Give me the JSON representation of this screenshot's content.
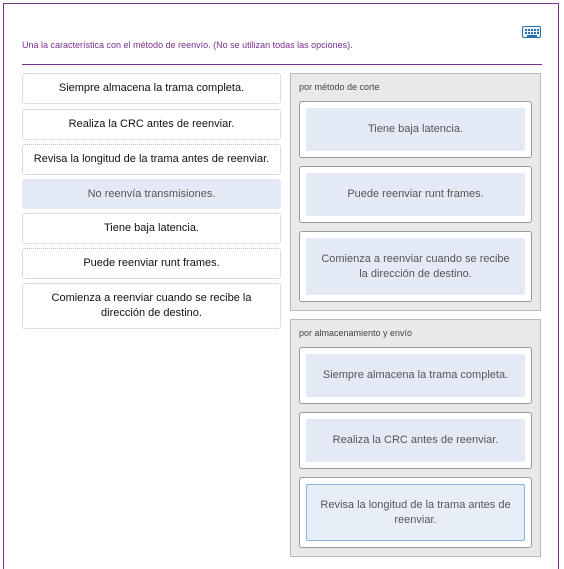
{
  "instruction": "Una la característica con el método de reenvío. (No se utilizan todas las opciones).",
  "keyboard_icon": "keyboard-icon",
  "options": [
    {
      "label": "Siempre almacena la trama completa.",
      "used": false
    },
    {
      "label": "Realiza la CRC antes de reenviar.",
      "used": false
    },
    {
      "label": "Revisa la longitud de la trama antes de reenviar.",
      "used": false
    },
    {
      "label": "No reenvía transmisiones.",
      "used": true
    },
    {
      "label": "Tiene baja latencia.",
      "used": false
    },
    {
      "label": "Puede reenviar runt frames.",
      "used": false
    },
    {
      "label": "Comienza a reenviar cuando se recibe la dirección de destino.",
      "used": false
    }
  ],
  "zones": [
    {
      "title": "por método de corte",
      "items": [
        "Tiene baja latencia.",
        "Puede reenviar runt frames.",
        "Comienza a reenviar cuando se recibe la dirección de destino."
      ]
    },
    {
      "title": "por almacenamiento y envío",
      "items": [
        "Siempre almacena la trama completa.",
        "Realiza la CRC antes de reenviar.",
        "Revisa la longitud de la trama antes de reenviar."
      ]
    }
  ]
}
